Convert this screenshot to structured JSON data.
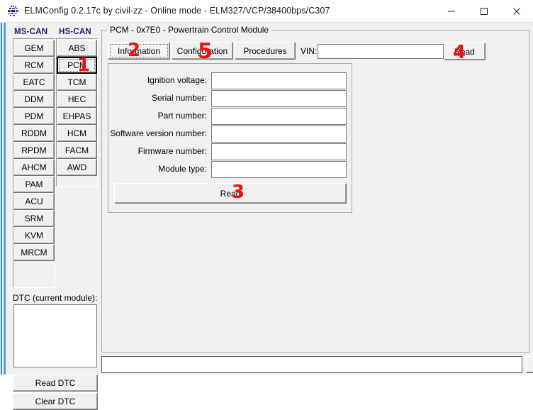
{
  "window": {
    "title": "ELMConfig 0.2.17c by civil-zz - Online mode - ELM327/VCP/38400bps/C307",
    "icon_name": "elmconfig-app-icon",
    "minimize_label": "—",
    "maximize_label": "□",
    "close_label": "×"
  },
  "sidebar": {
    "mscan_header": "MS-CAN",
    "hscan_header": "HS-CAN",
    "mscan_modules": [
      {
        "label": "GEM"
      },
      {
        "label": "RCM"
      },
      {
        "label": "EATC"
      },
      {
        "label": "DDM"
      },
      {
        "label": "PDM"
      },
      {
        "label": "RDDM"
      },
      {
        "label": "RPDM"
      },
      {
        "label": "AHCM"
      },
      {
        "label": "PAM"
      },
      {
        "label": "ACU"
      },
      {
        "label": "SRM"
      },
      {
        "label": "KVM"
      },
      {
        "label": "MRCM"
      }
    ],
    "hscan_modules": [
      {
        "label": "ABS"
      },
      {
        "label": "PCM",
        "selected": true
      },
      {
        "label": "TCM"
      },
      {
        "label": "HEC"
      },
      {
        "label": "EHPAS"
      },
      {
        "label": "HCM"
      },
      {
        "label": "FACM"
      },
      {
        "label": "AWD"
      }
    ],
    "dtc_label": "DTC (current module):",
    "dtc_items": [],
    "read_dtc_label": "Read DTC",
    "clear_dtc_label": "Clear DTC"
  },
  "main": {
    "group_title": "PCM - 0x7E0 - Powertrain Control Module",
    "tabs": [
      {
        "label": "Information",
        "active": true
      },
      {
        "label": "Configuration",
        "active": false
      },
      {
        "label": "Procedures",
        "active": false
      }
    ],
    "vin_label": "VIN:",
    "vin_value": "",
    "vin_placeholder": "",
    "vin_read_label": "Read",
    "information": {
      "fields": [
        {
          "label": "Ignition voltage:",
          "value": ""
        },
        {
          "label": "Serial number:",
          "value": ""
        },
        {
          "label": "Part number:",
          "value": ""
        },
        {
          "label": "Software version number:",
          "value": ""
        },
        {
          "label": "Firmware number:",
          "value": ""
        },
        {
          "label": "Module type:",
          "value": ""
        }
      ],
      "read_label": "Read"
    }
  },
  "log": {
    "value": "",
    "send_label": ""
  },
  "annotations": [
    {
      "id": "1",
      "text": "1",
      "target": "pcm-module-button"
    },
    {
      "id": "2",
      "text": "2",
      "target": "tab-information"
    },
    {
      "id": "3",
      "text": "3",
      "target": "information-read-button"
    },
    {
      "id": "4",
      "text": "4",
      "target": "vin-read-button"
    },
    {
      "id": "5",
      "text": "5",
      "target": "tab-configuration"
    }
  ],
  "colors": {
    "annotation_red": "#ee1111",
    "can_header_blue": "#1e1e6e",
    "window_face": "#f0f0f0",
    "field_white": "#ffffff"
  }
}
